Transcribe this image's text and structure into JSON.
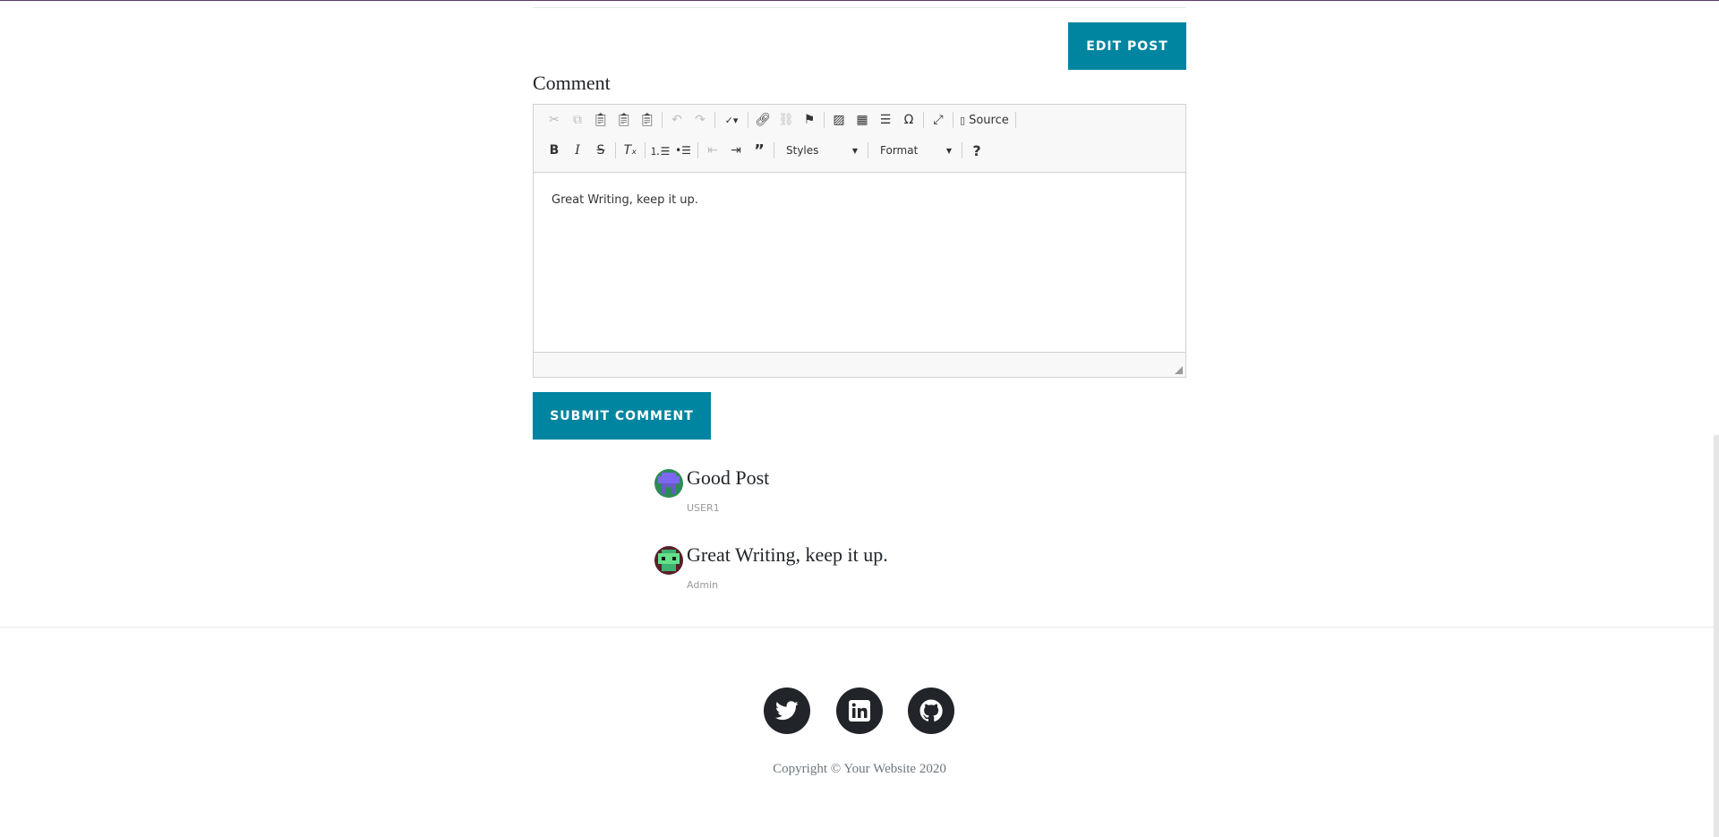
{
  "edit_post_label": "EDIT POST",
  "comment_heading": "Comment",
  "editor": {
    "toolbar_row1": [
      "cut",
      "copy",
      "paste",
      "paste-text",
      "paste-word",
      "undo",
      "redo",
      "spellcheck",
      "link",
      "unlink",
      "anchor",
      "image",
      "table",
      "horizontal-rule",
      "special-char",
      "maximize",
      "source"
    ],
    "source_label": "Source",
    "styles_label": "Styles",
    "format_label": "Format",
    "content": "Great Writing, keep it up."
  },
  "submit_label": "SUBMIT COMMENT",
  "comments": [
    {
      "title": "Good Post",
      "author": "USER1"
    },
    {
      "title": "Great Writing, keep it up.",
      "author": "Admin"
    }
  ],
  "social": [
    "twitter",
    "linkedin",
    "github"
  ],
  "copyright": "Copyright © Your Website 2020",
  "colors": {
    "accent": "#0085a1",
    "dark": "#212529"
  }
}
